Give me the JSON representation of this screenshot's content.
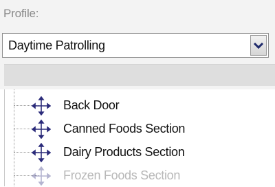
{
  "profile": {
    "label": "Profile:",
    "selected": "Daytime Patrolling"
  },
  "tree": {
    "items": [
      {
        "label": "Back Door",
        "icon": "move-cross-arrows-icon"
      },
      {
        "label": "Canned Foods Section",
        "icon": "move-cross-arrows-icon"
      },
      {
        "label": "Dairy Products Section",
        "icon": "move-cross-arrows-icon"
      },
      {
        "label": "Frozen Foods Section",
        "icon": "move-cross-arrows-icon"
      }
    ]
  },
  "colors": {
    "background": "#f3f3f3",
    "toolbar": "#dedede",
    "text": "#111111",
    "icon": "#2b2b7a"
  }
}
